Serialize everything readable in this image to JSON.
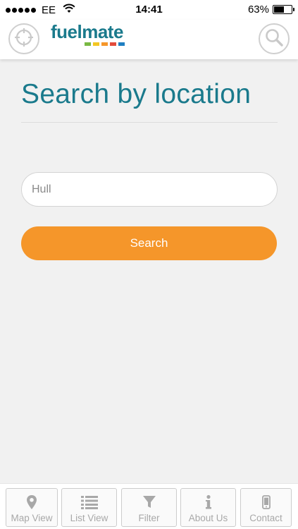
{
  "status_bar": {
    "carrier": "EE",
    "time": "14:41",
    "battery_percent": "63%",
    "battery_level": 0.63,
    "signal_icon": "signal-dots-icon",
    "wifi_icon": "wifi-icon"
  },
  "header": {
    "logo_text": "fuelmate",
    "logo_bar_colors": [
      "#79b943",
      "#f3c623",
      "#f5962a",
      "#e34b3b",
      "#1f7fc2"
    ],
    "left_icon": "crosshair-icon",
    "right_icon": "search-icon"
  },
  "main": {
    "title": "Search by location",
    "search_value": "Hull",
    "search_button_label": "Search"
  },
  "colors": {
    "brand_teal": "#1a7a8c",
    "accent_orange": "#f5962a",
    "tab_icon_gray": "#a8a8a8"
  },
  "tabs": [
    {
      "label": "Map View",
      "icon": "map-pin-icon"
    },
    {
      "label": "List View",
      "icon": "list-icon"
    },
    {
      "label": "Filter",
      "icon": "filter-icon"
    },
    {
      "label": "About Us",
      "icon": "info-icon"
    },
    {
      "label": "Contact",
      "icon": "phone-icon"
    }
  ]
}
